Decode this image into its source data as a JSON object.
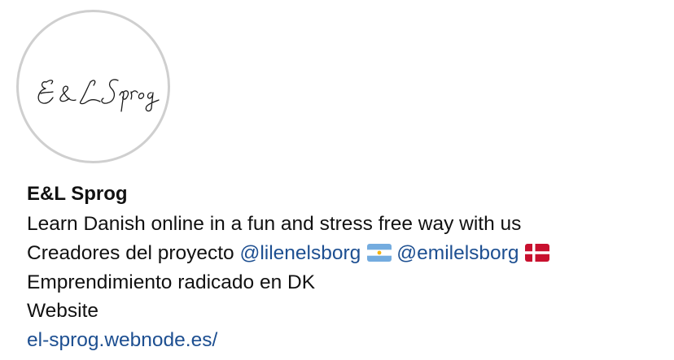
{
  "profile": {
    "logo_text": "E&L Sprog",
    "name": "E&L Sprog"
  },
  "bio": {
    "line1": "Learn Danish online in a fun and stress free way with us",
    "line2_prefix": "Creadores del proyecto ",
    "mention1": "@lilenelsborg",
    "flag1_icon": "argentina-flag-icon",
    "mention2": "@emilelsborg",
    "flag2_icon": "denmark-flag-icon",
    "line3": "Emprendimiento radicado en DK",
    "line4": "Website",
    "website_url": "el-sprog.webnode.es/"
  },
  "colors": {
    "link": "#1d4f91",
    "text": "#111111",
    "avatar_border": "#cfcfcf"
  }
}
